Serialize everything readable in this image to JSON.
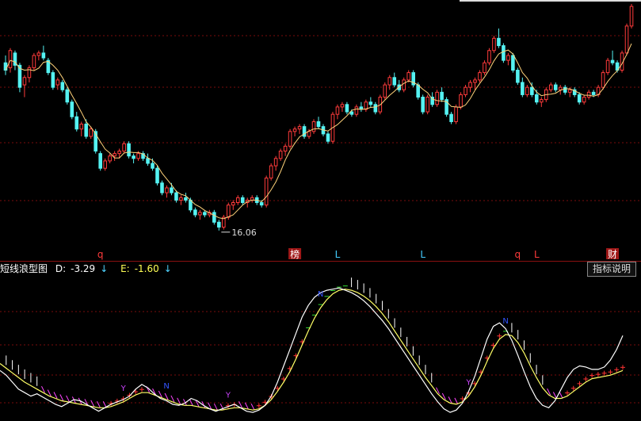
{
  "indicator": {
    "name": "短线浪型图",
    "d_label": "D:",
    "d_value": "-3.29",
    "d_arrow": "↓",
    "e_label": "E:",
    "e_value": "-1.60",
    "e_arrow": "↓",
    "help_button": "指标说明"
  },
  "colors": {
    "up_candle": "#ff3b3b",
    "down_candle": "#55f2f2",
    "ma_line": "#ffd27a",
    "grid": "#7a0d0d",
    "d_line": "#ffffff",
    "e_line": "#ffff66",
    "up_tick": "#ff3333",
    "down_tick": "#ffffff",
    "mid_tick": "#33dd33",
    "low_tick": "#ff44ff"
  },
  "chart_data": [
    {
      "type": "candlestick",
      "low_annotation": "16.06",
      "event_markers": [
        {
          "bar": 20,
          "label": "q",
          "color": "#ff3b3b",
          "boxed": false
        },
        {
          "bar": 61,
          "label": "榜",
          "color": "#ffffff",
          "boxed": true
        },
        {
          "bar": 70,
          "label": "L",
          "color": "#44ccff",
          "boxed": false
        },
        {
          "bar": 88,
          "label": "L",
          "color": "#44ccff",
          "boxed": false
        },
        {
          "bar": 108,
          "label": "q",
          "color": "#ff3b3b",
          "boxed": false
        },
        {
          "bar": 112,
          "label": "L",
          "color": "#ff3b3b",
          "boxed": false
        },
        {
          "bar": 128,
          "label": "财",
          "color": "#ffffff",
          "boxed": true
        }
      ],
      "ohlc": [
        [
          22.9,
          23.2,
          22.4,
          22.6
        ],
        [
          22.7,
          23.5,
          22.5,
          23.4
        ],
        [
          23.3,
          23.4,
          22.6,
          22.8
        ],
        [
          22.8,
          22.9,
          21.7,
          21.9
        ],
        [
          22.0,
          22.4,
          21.5,
          22.3
        ],
        [
          22.3,
          22.8,
          22.1,
          22.7
        ],
        [
          22.7,
          23.3,
          22.6,
          23.2
        ],
        [
          23.2,
          23.4,
          23.0,
          23.3
        ],
        [
          23.3,
          23.6,
          23.0,
          23.1
        ],
        [
          23.0,
          23.1,
          22.4,
          22.5
        ],
        [
          22.5,
          22.6,
          21.8,
          21.9
        ],
        [
          22.0,
          22.3,
          21.8,
          22.2
        ],
        [
          22.1,
          22.2,
          21.7,
          21.8
        ],
        [
          21.8,
          21.9,
          21.2,
          21.3
        ],
        [
          21.3,
          21.4,
          20.6,
          20.7
        ],
        [
          20.7,
          20.9,
          20.1,
          20.2
        ],
        [
          20.2,
          20.5,
          19.9,
          20.4
        ],
        [
          20.4,
          20.6,
          19.8,
          19.9
        ],
        [
          19.9,
          20.3,
          19.8,
          20.2
        ],
        [
          20.1,
          20.2,
          19.2,
          19.3
        ],
        [
          19.2,
          19.3,
          18.5,
          18.6
        ],
        [
          18.6,
          19.0,
          18.5,
          18.9
        ],
        [
          18.9,
          19.2,
          18.8,
          19.1
        ],
        [
          19.1,
          19.3,
          18.9,
          19.2
        ],
        [
          19.2,
          19.4,
          19.0,
          19.3
        ],
        [
          19.3,
          19.7,
          19.2,
          19.6
        ],
        [
          19.6,
          19.7,
          19.0,
          19.1
        ],
        [
          19.1,
          19.2,
          18.8,
          19.0
        ],
        [
          19.0,
          19.3,
          18.9,
          19.2
        ],
        [
          19.2,
          19.3,
          18.9,
          19.0
        ],
        [
          19.0,
          19.2,
          18.7,
          18.8
        ],
        [
          18.8,
          19.0,
          18.5,
          18.6
        ],
        [
          18.6,
          18.7,
          17.9,
          18.0
        ],
        [
          18.0,
          18.1,
          17.5,
          17.6
        ],
        [
          17.6,
          17.9,
          17.4,
          17.8
        ],
        [
          17.8,
          18.0,
          17.5,
          17.6
        ],
        [
          17.6,
          17.7,
          17.2,
          17.3
        ],
        [
          17.3,
          17.5,
          17.1,
          17.4
        ],
        [
          17.4,
          17.6,
          17.2,
          17.3
        ],
        [
          17.3,
          17.4,
          16.8,
          16.9
        ],
        [
          16.9,
          17.0,
          16.6,
          16.7
        ],
        [
          16.7,
          16.9,
          16.5,
          16.8
        ],
        [
          16.8,
          16.9,
          16.6,
          16.7
        ],
        [
          16.7,
          16.9,
          16.6,
          16.8
        ],
        [
          16.8,
          16.9,
          16.3,
          16.4
        ],
        [
          16.4,
          16.5,
          16.06,
          16.2
        ],
        [
          16.2,
          16.7,
          16.1,
          16.6
        ],
        [
          16.6,
          17.2,
          16.5,
          17.1
        ],
        [
          17.1,
          17.3,
          16.9,
          17.2
        ],
        [
          17.2,
          17.5,
          17.1,
          17.4
        ],
        [
          17.4,
          17.5,
          17.1,
          17.2
        ],
        [
          17.2,
          17.4,
          17.0,
          17.3
        ],
        [
          17.3,
          17.5,
          17.2,
          17.4
        ],
        [
          17.4,
          17.5,
          17.1,
          17.2
        ],
        [
          17.2,
          17.3,
          17.0,
          17.1
        ],
        [
          17.1,
          18.3,
          17.0,
          18.2
        ],
        [
          18.2,
          18.8,
          18.1,
          18.7
        ],
        [
          18.7,
          19.1,
          18.5,
          19.0
        ],
        [
          19.0,
          19.4,
          18.9,
          19.3
        ],
        [
          19.3,
          19.6,
          19.1,
          19.5
        ],
        [
          19.5,
          20.2,
          19.4,
          20.1
        ],
        [
          20.1,
          20.3,
          19.9,
          20.2
        ],
        [
          20.2,
          20.4,
          20.0,
          20.3
        ],
        [
          20.3,
          20.4,
          19.8,
          19.9
        ],
        [
          19.9,
          20.2,
          19.8,
          20.1
        ],
        [
          20.1,
          20.6,
          20.0,
          20.5
        ],
        [
          20.5,
          20.7,
          20.2,
          20.3
        ],
        [
          20.3,
          20.4,
          19.9,
          20.0
        ],
        [
          20.0,
          20.1,
          19.6,
          19.7
        ],
        [
          19.7,
          20.9,
          19.6,
          20.8
        ],
        [
          20.8,
          21.2,
          20.6,
          21.1
        ],
        [
          21.1,
          21.3,
          20.9,
          21.2
        ],
        [
          21.2,
          21.3,
          20.8,
          20.9
        ],
        [
          20.9,
          21.0,
          20.7,
          20.8
        ],
        [
          20.8,
          21.2,
          20.7,
          21.1
        ],
        [
          21.1,
          21.3,
          20.9,
          21.0
        ],
        [
          21.0,
          21.4,
          20.9,
          21.3
        ],
        [
          21.3,
          21.5,
          21.1,
          21.2
        ],
        [
          21.2,
          21.3,
          20.8,
          20.9
        ],
        [
          20.9,
          21.6,
          20.8,
          21.5
        ],
        [
          21.5,
          22.1,
          21.4,
          22.0
        ],
        [
          22.0,
          22.4,
          21.8,
          22.3
        ],
        [
          22.3,
          22.5,
          21.9,
          22.0
        ],
        [
          22.0,
          22.2,
          21.7,
          21.8
        ],
        [
          21.8,
          22.3,
          21.7,
          22.2
        ],
        [
          22.2,
          22.6,
          22.1,
          22.5
        ],
        [
          22.5,
          22.6,
          21.9,
          22.0
        ],
        [
          22.0,
          22.1,
          21.4,
          21.5
        ],
        [
          21.5,
          21.6,
          20.8,
          20.9
        ],
        [
          20.9,
          21.6,
          20.8,
          21.5
        ],
        [
          21.5,
          21.7,
          21.1,
          21.2
        ],
        [
          21.2,
          21.8,
          21.1,
          21.7
        ],
        [
          21.7,
          21.9,
          21.3,
          21.4
        ],
        [
          21.4,
          21.5,
          20.7,
          20.8
        ],
        [
          20.8,
          20.9,
          20.4,
          20.5
        ],
        [
          20.5,
          21.2,
          20.4,
          21.1
        ],
        [
          21.1,
          21.7,
          21.0,
          21.6
        ],
        [
          21.6,
          22.0,
          21.5,
          21.9
        ],
        [
          21.9,
          22.2,
          21.7,
          22.1
        ],
        [
          22.1,
          22.3,
          21.8,
          22.2
        ],
        [
          22.2,
          22.6,
          22.1,
          22.5
        ],
        [
          22.5,
          23.0,
          22.4,
          22.9
        ],
        [
          22.9,
          23.5,
          22.8,
          23.4
        ],
        [
          23.4,
          24.0,
          23.3,
          23.9
        ],
        [
          23.9,
          24.3,
          23.5,
          23.6
        ],
        [
          23.6,
          23.7,
          22.9,
          23.0
        ],
        [
          23.0,
          23.3,
          22.8,
          23.2
        ],
        [
          23.2,
          23.3,
          22.5,
          22.6
        ],
        [
          22.6,
          22.7,
          22.0,
          22.1
        ],
        [
          22.1,
          22.3,
          21.5,
          21.6
        ],
        [
          21.6,
          22.0,
          21.5,
          21.9
        ],
        [
          21.9,
          22.1,
          21.5,
          21.6
        ],
        [
          21.6,
          21.8,
          21.2,
          21.3
        ],
        [
          21.3,
          21.5,
          21.1,
          21.4
        ],
        [
          21.4,
          21.9,
          21.3,
          21.8
        ],
        [
          21.8,
          22.1,
          21.7,
          22.0
        ],
        [
          22.0,
          22.1,
          21.7,
          21.8
        ],
        [
          21.8,
          22.0,
          21.6,
          21.9
        ],
        [
          21.9,
          22.0,
          21.6,
          21.7
        ],
        [
          21.7,
          21.9,
          21.5,
          21.8
        ],
        [
          21.8,
          21.9,
          21.5,
          21.6
        ],
        [
          21.6,
          21.7,
          21.2,
          21.3
        ],
        [
          21.3,
          21.6,
          21.2,
          21.5
        ],
        [
          21.5,
          21.8,
          21.4,
          21.7
        ],
        [
          21.7,
          21.8,
          21.5,
          21.6
        ],
        [
          21.6,
          22.0,
          21.5,
          21.9
        ],
        [
          21.9,
          22.6,
          21.8,
          22.5
        ],
        [
          22.5,
          23.1,
          22.4,
          23.0
        ],
        [
          23.0,
          23.4,
          22.8,
          22.9
        ],
        [
          22.9,
          23.0,
          22.5,
          22.6
        ],
        [
          22.6,
          23.4,
          22.5,
          23.3
        ],
        [
          23.3,
          24.5,
          23.2,
          24.4
        ],
        [
          24.4,
          25.3,
          24.3,
          25.2
        ]
      ],
      "ylim": [
        15.6,
        25.3
      ]
    },
    {
      "type": "line",
      "series": [
        {
          "name": "D",
          "values": [
            -1.0,
            -1.4,
            -2.0,
            -2.6,
            -2.9,
            -3.2,
            -3.0,
            -3.3,
            -3.6,
            -3.9,
            -4.1,
            -3.8,
            -3.5,
            -3.6,
            -3.9,
            -4.2,
            -4.5,
            -4.2,
            -3.9,
            -3.7,
            -3.5,
            -3.2,
            -2.6,
            -2.2,
            -2.5,
            -3.0,
            -3.4,
            -3.6,
            -3.9,
            -4.0,
            -3.8,
            -3.4,
            -3.6,
            -4.0,
            -4.3,
            -4.5,
            -4.3,
            -4.1,
            -3.9,
            -4.2,
            -4.5,
            -4.6,
            -4.4,
            -4.0,
            -3.2,
            -2.0,
            -0.6,
            0.8,
            2.2,
            3.6,
            4.6,
            5.3,
            5.7,
            5.9,
            6.0,
            6.1,
            5.9,
            5.7,
            5.4,
            5.0,
            4.5,
            3.9,
            3.3,
            2.6,
            1.8,
            1.0,
            0.2,
            -0.6,
            -1.4,
            -2.2,
            -3.0,
            -3.7,
            -4.3,
            -4.6,
            -4.4,
            -3.8,
            -2.8,
            -1.5,
            0.1,
            1.7,
            2.8,
            3.1,
            2.6,
            1.6,
            0.3,
            -1.1,
            -2.4,
            -3.4,
            -4.0,
            -4.2,
            -3.6,
            -2.6,
            -1.6,
            -0.9,
            -0.6,
            -0.7,
            -0.9,
            -0.9,
            -0.7,
            -0.1,
            0.8,
            2.0
          ]
        },
        {
          "name": "E",
          "values": [
            -0.4,
            -0.8,
            -1.2,
            -1.6,
            -2.0,
            -2.3,
            -2.6,
            -2.9,
            -3.2,
            -3.4,
            -3.6,
            -3.7,
            -3.8,
            -3.9,
            -4.0,
            -4.1,
            -4.2,
            -4.2,
            -4.1,
            -3.9,
            -3.7,
            -3.4,
            -3.1,
            -2.9,
            -2.9,
            -3.1,
            -3.3,
            -3.5,
            -3.7,
            -3.9,
            -4.0,
            -4.0,
            -4.1,
            -4.2,
            -4.3,
            -4.4,
            -4.4,
            -4.3,
            -4.2,
            -4.2,
            -4.3,
            -4.4,
            -4.3,
            -4.0,
            -3.5,
            -2.8,
            -2.0,
            -1.1,
            0.0,
            1.2,
            2.4,
            3.5,
            4.4,
            5.1,
            5.6,
            5.9,
            6.0,
            5.9,
            5.7,
            5.4,
            5.0,
            4.5,
            3.9,
            3.2,
            2.4,
            1.6,
            0.8,
            0.0,
            -0.8,
            -1.6,
            -2.3,
            -3.0,
            -3.5,
            -3.8,
            -3.9,
            -3.7,
            -3.2,
            -2.4,
            -1.4,
            -0.2,
            0.9,
            1.7,
            2.1,
            2.0,
            1.4,
            0.5,
            -0.6,
            -1.6,
            -2.5,
            -3.1,
            -3.4,
            -3.4,
            -3.2,
            -2.8,
            -2.4,
            -2.0,
            -1.7,
            -1.6,
            -1.5,
            -1.4,
            -1.2,
            -1.0
          ]
        }
      ],
      "ylim": [
        -5.0,
        7.0
      ],
      "markers": [
        {
          "index": 20,
          "label": "Y",
          "color": "#cc44ff"
        },
        {
          "index": 27,
          "label": "N",
          "color": "#3355ff"
        },
        {
          "index": 37,
          "label": "Y",
          "color": "#cc44ff"
        },
        {
          "index": 52,
          "label": "N",
          "color": "#3355ff"
        },
        {
          "index": 76,
          "label": "Y",
          "color": "#cc44ff"
        },
        {
          "index": 82,
          "label": "N",
          "color": "#3355ff"
        }
      ]
    }
  ]
}
